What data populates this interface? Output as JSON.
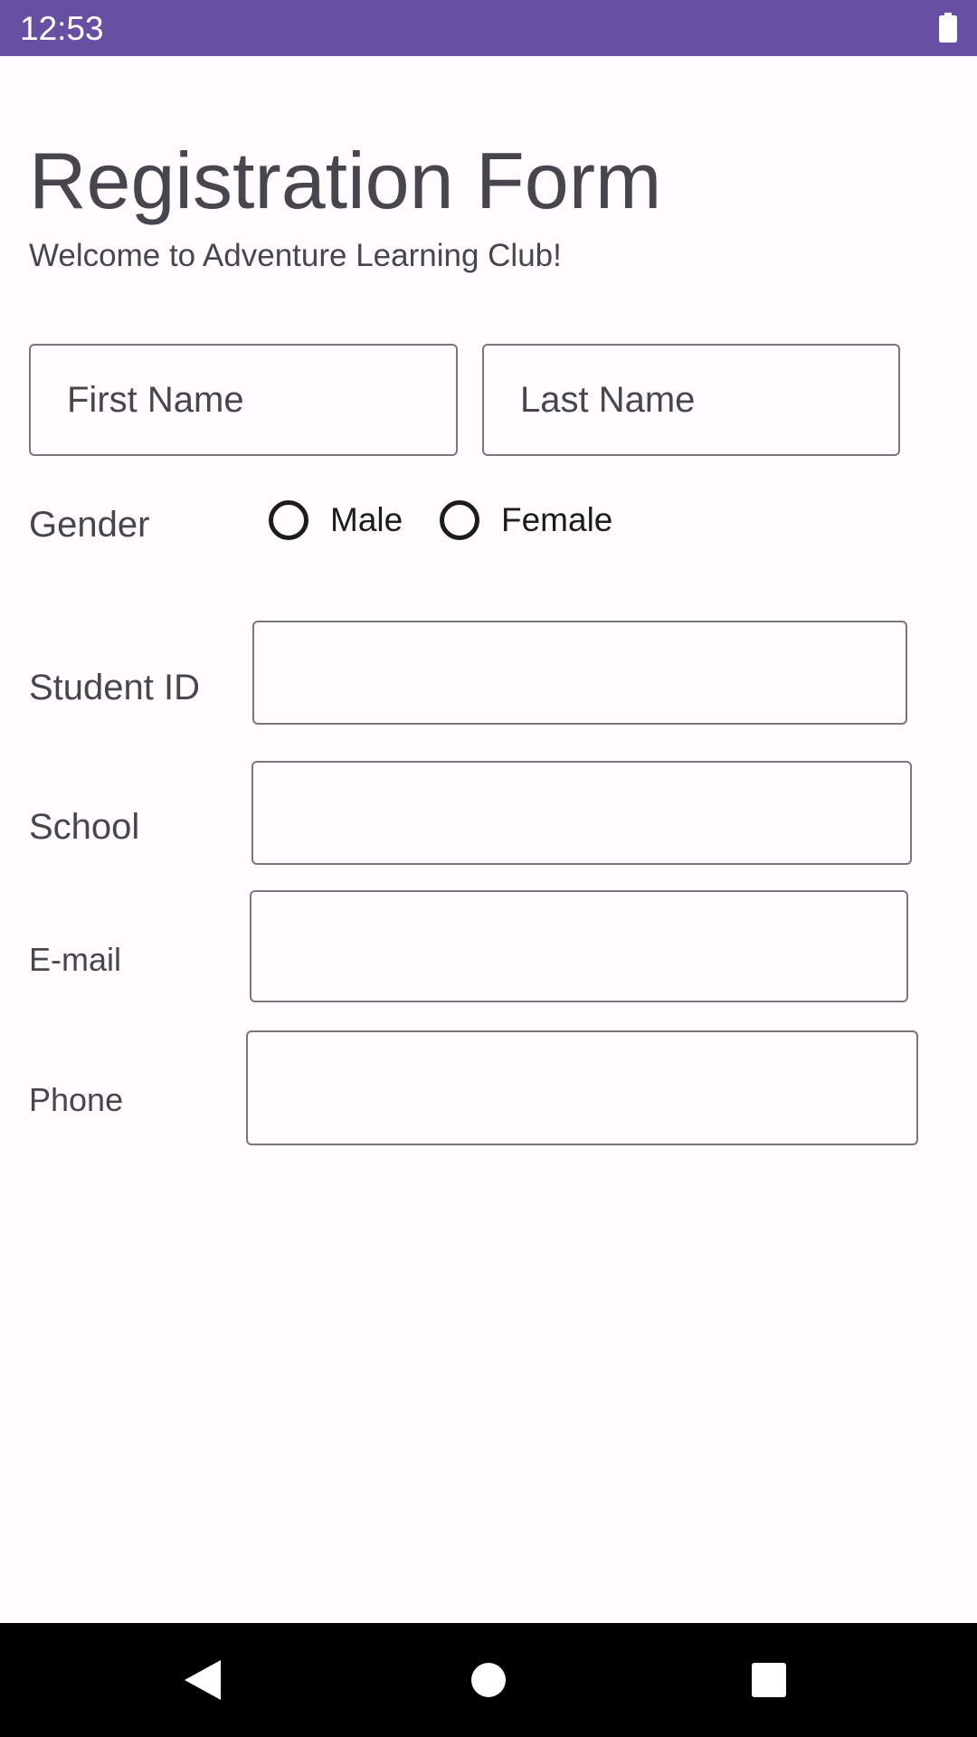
{
  "status_bar": {
    "time": "12:53",
    "battery_icon": "battery-full-icon",
    "background_color": "#6750a4"
  },
  "form": {
    "title": "Registration Form",
    "subtitle": "Welcome to Adventure Learning Club!",
    "first_name": {
      "placeholder": "First Name",
      "value": ""
    },
    "last_name": {
      "placeholder": "Last Name",
      "value": ""
    },
    "gender": {
      "label": "Gender",
      "options": [
        "Male",
        "Female"
      ],
      "selected": null
    },
    "student_id": {
      "label": "Student ID",
      "value": ""
    },
    "school": {
      "label": "School",
      "value": ""
    },
    "email": {
      "label": "E-mail",
      "value": ""
    },
    "phone": {
      "label": "Phone",
      "value": ""
    }
  },
  "nav_bar": {
    "back_icon": "back-triangle-icon",
    "home_icon": "home-circle-icon",
    "recents_icon": "recents-square-icon"
  }
}
